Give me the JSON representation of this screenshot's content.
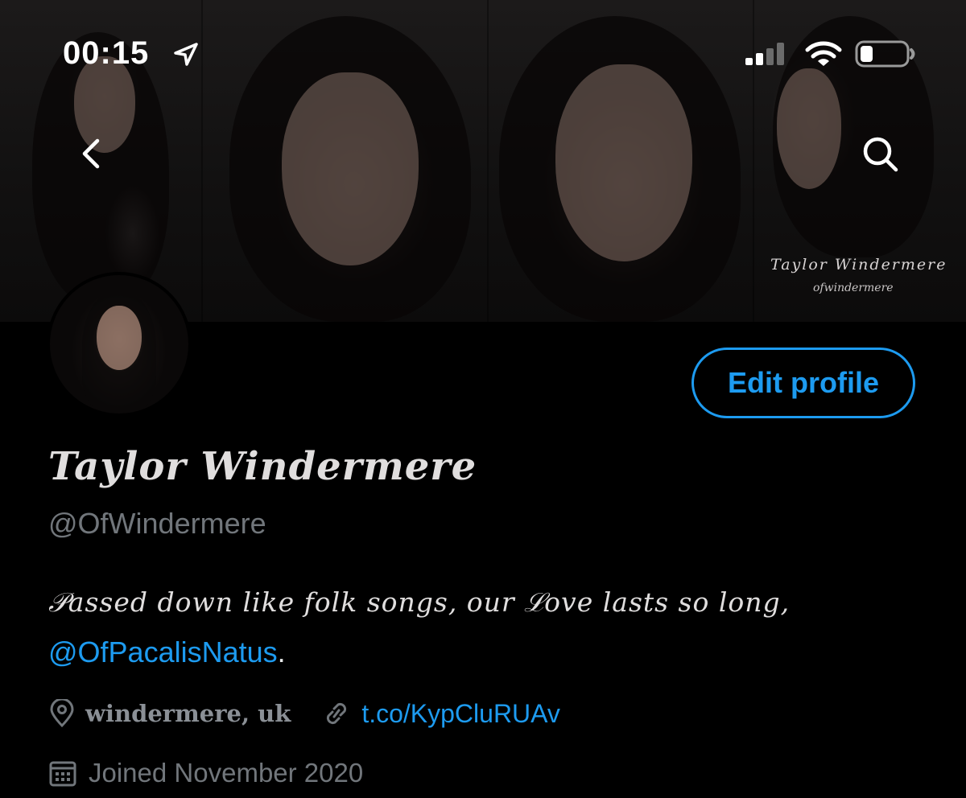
{
  "status_bar": {
    "time": "00:15",
    "icons": [
      "location-arrow-icon",
      "cellular-signal-icon",
      "wifi-icon",
      "battery-icon"
    ]
  },
  "header": {
    "back_icon": "chevron-left-icon",
    "search_icon": "search-icon",
    "banner_watermark": {
      "name": "Taylor Windermere",
      "handle": "ofwindermere"
    }
  },
  "profile": {
    "edit_button_label": "Edit profile",
    "display_name": "Taylor Windermere",
    "handle": "@OfWindermere",
    "bio_line": "𝒫assed down like folk songs, our ℒove lasts so long,",
    "bio_mention": "@OfPacalisNatus",
    "bio_suffix": ".",
    "location": "windermere, uk",
    "link": "t.co/KypCluRUAv",
    "joined": "Joined November 2020"
  },
  "colors": {
    "accent": "#1d9bf0",
    "background": "#000000",
    "secondary_text": "#71767b"
  }
}
